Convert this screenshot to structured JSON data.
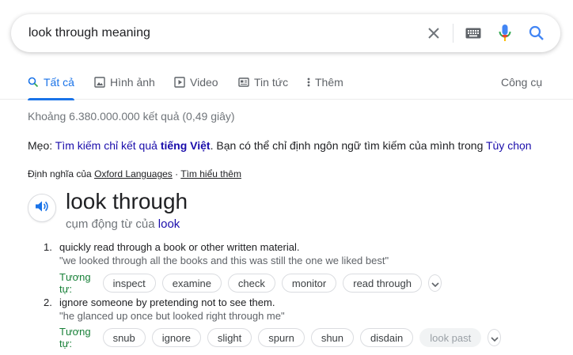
{
  "search": {
    "query": "look through meaning"
  },
  "tabs": [
    {
      "label": "Tất cả",
      "icon": "search-icon"
    },
    {
      "label": "Hình ảnh",
      "icon": "image-icon"
    },
    {
      "label": "Video",
      "icon": "play-icon"
    },
    {
      "label": "Tin tức",
      "icon": "news-icon"
    },
    {
      "label": "Thêm",
      "icon": "more-vert-icon"
    },
    {
      "label": "Công cụ"
    }
  ],
  "stats": "Khoảng 6.380.000.000 kết quả (0,49 giây)",
  "tip": {
    "prefix": "Mẹo: ",
    "link1": "Tìm kiếm chỉ kết quả",
    "link1_bold": "tiếng Việt",
    "middle": ". Bạn có thể chỉ định ngôn ngữ tìm kiếm của mình trong ",
    "link2": "Tùy chọn"
  },
  "definition_source": {
    "prefix": "Định nghĩa của ",
    "source": "Oxford Languages",
    "separator": " · ",
    "learn_more": "Tìm hiểu thêm"
  },
  "dictionary": {
    "headword": "look through",
    "pos_prefix": "cụm động từ của ",
    "pos_link": "look",
    "synonym_label": "Tương tự:",
    "senses": [
      {
        "num": "1.",
        "gloss": "quickly read through a book or other written material.",
        "example": "\"we looked through all the books and this was still the one we liked best\"",
        "synonyms": [
          "inspect",
          "examine",
          "check",
          "monitor",
          "read through"
        ],
        "disabled": []
      },
      {
        "num": "2.",
        "gloss": "ignore someone by pretending not to see them.",
        "example": "\"he glanced up once but looked right through me\"",
        "synonyms": [
          "snub",
          "ignore",
          "slight",
          "spurn",
          "shun",
          "disdain"
        ],
        "disabled": [
          "look past"
        ]
      }
    ]
  },
  "colors": {
    "accent": "#1a73e8",
    "link": "#1a0dab",
    "synonym_label": "#188038"
  }
}
